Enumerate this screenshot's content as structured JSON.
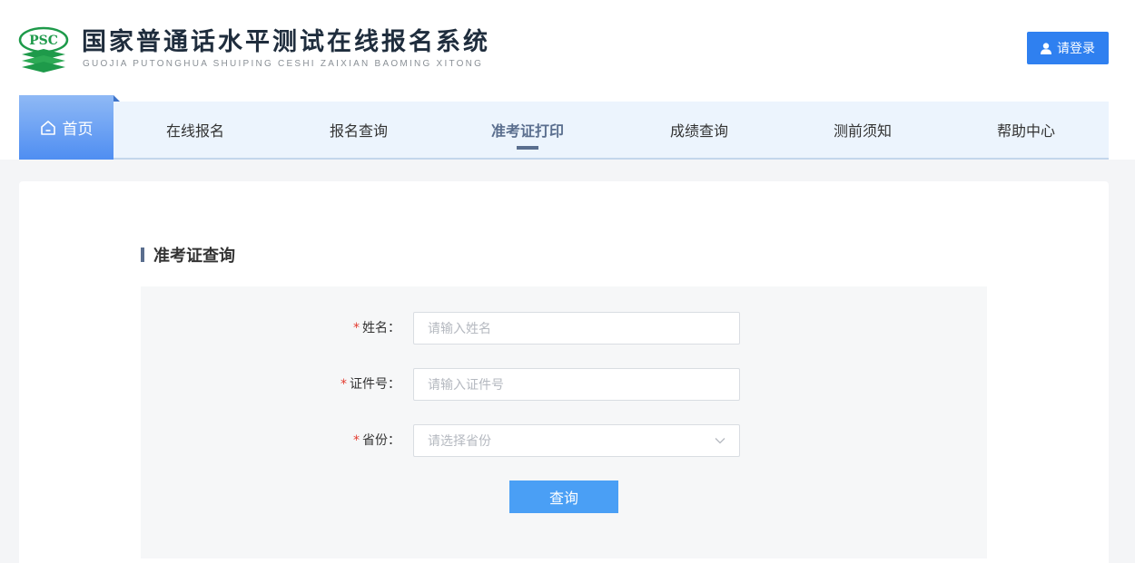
{
  "header": {
    "logo_text": "PSC",
    "title": "国家普通话水平测试在线报名系统",
    "subtitle": "GUOJIA PUTONGHUA SHUIPING CESHI ZAIXIAN BAOMING XITONG",
    "login_label": "请登录",
    "brand_color": "#2f80f0"
  },
  "nav": {
    "home_label": "首页",
    "items": [
      {
        "label": "在线报名"
      },
      {
        "label": "报名查询"
      },
      {
        "label": "准考证打印",
        "active": true
      },
      {
        "label": "成绩查询"
      },
      {
        "label": "测前须知"
      },
      {
        "label": "帮助中心"
      }
    ]
  },
  "main": {
    "section_title": "准考证查询",
    "form": {
      "name": {
        "required_mark": "*",
        "label": "姓名：",
        "placeholder": "请输入姓名",
        "value": ""
      },
      "id_number": {
        "required_mark": "*",
        "label": "证件号：",
        "placeholder": "请输入证件号",
        "value": ""
      },
      "province": {
        "required_mark": "*",
        "label": "省份：",
        "placeholder": "请选择省份",
        "icon": "chevron-down-icon"
      },
      "submit_label": "查询"
    }
  }
}
